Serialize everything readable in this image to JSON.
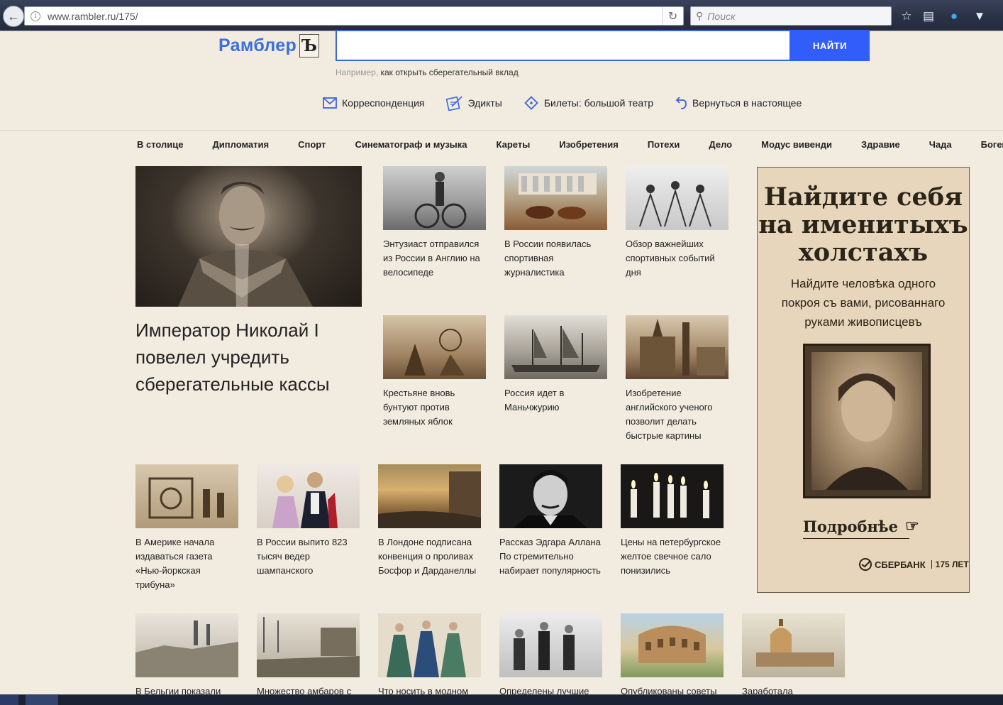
{
  "browser": {
    "url": "www.rambler.ru/175/",
    "search_placeholder": "Поиск"
  },
  "header": {
    "logo_text": "Рамблер",
    "logo_mark": "Ъ",
    "find_button": "НАЙТИ",
    "example_prefix": "Например,",
    "example_query": " как открыть сберегательный вклад"
  },
  "quicklinks": [
    {
      "label": "Корреспонденция",
      "icon": "envelope-icon"
    },
    {
      "label": "Эдикты",
      "icon": "quill-icon"
    },
    {
      "label": "Билеты: большой театр",
      "icon": "ticket-icon"
    },
    {
      "label": "Вернуться в настоящее",
      "icon": "return-arrow-icon"
    }
  ],
  "categories": [
    "В столице",
    "Дипломатия",
    "Спорт",
    "Синематограф и музыка",
    "Кареты",
    "Изобретения",
    "Потехи",
    "Дело",
    "Модус вивенди",
    "Здравие",
    "Чада",
    "Богема"
  ],
  "feature": {
    "title": "Император Николай I повелел учредить сберегательные кассы"
  },
  "news": [
    "Энтузиаст отправился из России в Англию на велосипеде",
    "В России появилась спортивная журналистика",
    "Обзор важнейших спортивных событий дня",
    "Крестьяне вновь бунтуют против земляных яблок",
    "Россия идет в Маньчжурию",
    "Изобретение английского ученого позволит делать быстрые картины",
    "В Америке начала издаваться газета «Нью-йоркская трибуна»",
    "В России выпито 823 тысяч ведер шампанского",
    "В Лондоне подписана конвенция о проливах Босфор и Дарданеллы",
    "Рассказ Эдгара Аллана По стремительно набирает популярность",
    "Цены на петербургское желтое свечное сало понизились",
    "В Бельгии показали",
    "Множество амбаров с",
    "Что носить в модном",
    "Определены лучшие",
    "Опубликованы советы",
    "Заработала"
  ],
  "ad": {
    "title": "Найдите себя на именитыхъ холстахъ",
    "subtitle": "Найдите человѣка одного покроя съ вами, рисованнаго руками живописцевъ",
    "more": "Подробнѣе",
    "brand": "СБЕРБАНК",
    "brand_years": "175 ЛЕТ"
  }
}
